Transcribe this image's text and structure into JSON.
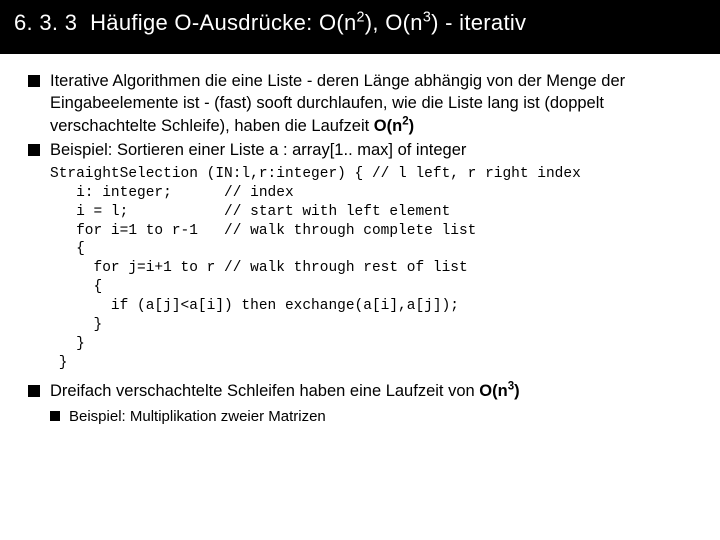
{
  "heading": {
    "section": "6. 3. 3",
    "title_pre": "Häufige O-Ausdrücke: O(n",
    "exp1": "2",
    "mid": "), O(n",
    "exp2": "3",
    "post": ") - iterativ"
  },
  "bullets": [
    {
      "text_pre": "Iterative Algorithmen die eine Liste - deren Länge abhängig von der Menge der Eingabeelemente ist - (fast) sooft durchlaufen, wie die Liste lang ist (doppelt verschachtelte Schleife), haben die Laufzeit ",
      "bold": "O(n",
      "bold_exp": "2",
      "bold_after": ")"
    },
    {
      "text_pre": "Beispiel: Sortieren einer Liste a : array[1.. max] of integer"
    }
  ],
  "code": "StraightSelection (IN:l,r:integer) { // l left, r right index\n   i: integer;      // index\n   i = l;           // start with left element\n   for i=1 to r-1   // walk through complete list\n   {\n     for j=i+1 to r // walk through rest of list\n     {\n       if (a[j]<a[i]) then exchange(a[i],a[j]);\n     }\n   }\n }",
  "bullet3": {
    "pre": "Dreifach verschachtelte Schleifen haben eine Laufzeit von ",
    "bold": "O(n",
    "bold_exp": "3",
    "bold_after": ")"
  },
  "sub_bullet": "Beispiel: Multiplikation zweier Matrizen"
}
